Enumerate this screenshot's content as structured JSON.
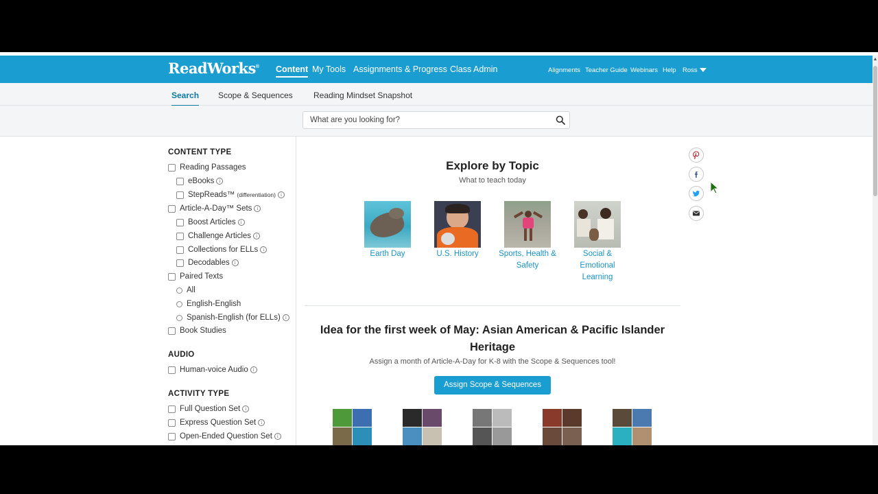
{
  "header": {
    "logo": "ReadWorks",
    "logo_mark": "®",
    "nav": [
      "Content",
      "My Tools",
      "Assignments & Progress",
      "Class Admin"
    ],
    "util": [
      "Alignments",
      "Teacher Guide",
      "Webinars",
      "Help"
    ],
    "user": "Ross",
    "brand_color": "#1a9dd0"
  },
  "subnav": {
    "tabs": [
      "Search",
      "Scope & Sequences",
      "Reading Mindset Snapshot"
    ],
    "active": "Search"
  },
  "search": {
    "placeholder": "What are you looking for?",
    "value": ""
  },
  "sidebar": {
    "content_type_title": "CONTENT TYPE",
    "content_type": {
      "reading_passages": "Reading Passages",
      "ebooks": "eBooks",
      "stepreads": "StepReads™",
      "stepreads_note": "(differentiation)",
      "article_a_day": "Article-A-Day™ Sets",
      "boost": "Boost Articles",
      "challenge": "Challenge Articles",
      "ells": "Collections for ELLs",
      "decodables": "Decodables",
      "paired": "Paired Texts",
      "paired_all": "All",
      "paired_en": "English-English",
      "paired_es": "Spanish-English (for ELLs)",
      "book_studies": "Book Studies"
    },
    "audio_title": "AUDIO",
    "audio": {
      "human": "Human-voice Audio"
    },
    "activity_title": "ACTIVITY TYPE",
    "activity": {
      "full": "Full Question Set",
      "express": "Express Question Set",
      "open": "Open-Ended Question Set"
    }
  },
  "main": {
    "explore_title": "Explore by Topic",
    "explore_sub": "What to teach today",
    "topics": [
      {
        "label": "Earth Day"
      },
      {
        "label": "U.S. History"
      },
      {
        "label": "Sports, Health & Safety"
      },
      {
        "label": "Social & Emotional Learning"
      }
    ],
    "idea_title": "Idea for the first week of May: Asian American & Pacific Islander Heritage",
    "idea_sub": "Assign a month of Article-A-Day for K-8 with the Scope & Sequences tool!",
    "assign_button": "Assign Scope & Sequences"
  },
  "social": [
    "pinterest-icon",
    "facebook-icon",
    "twitter-icon",
    "email-icon"
  ]
}
